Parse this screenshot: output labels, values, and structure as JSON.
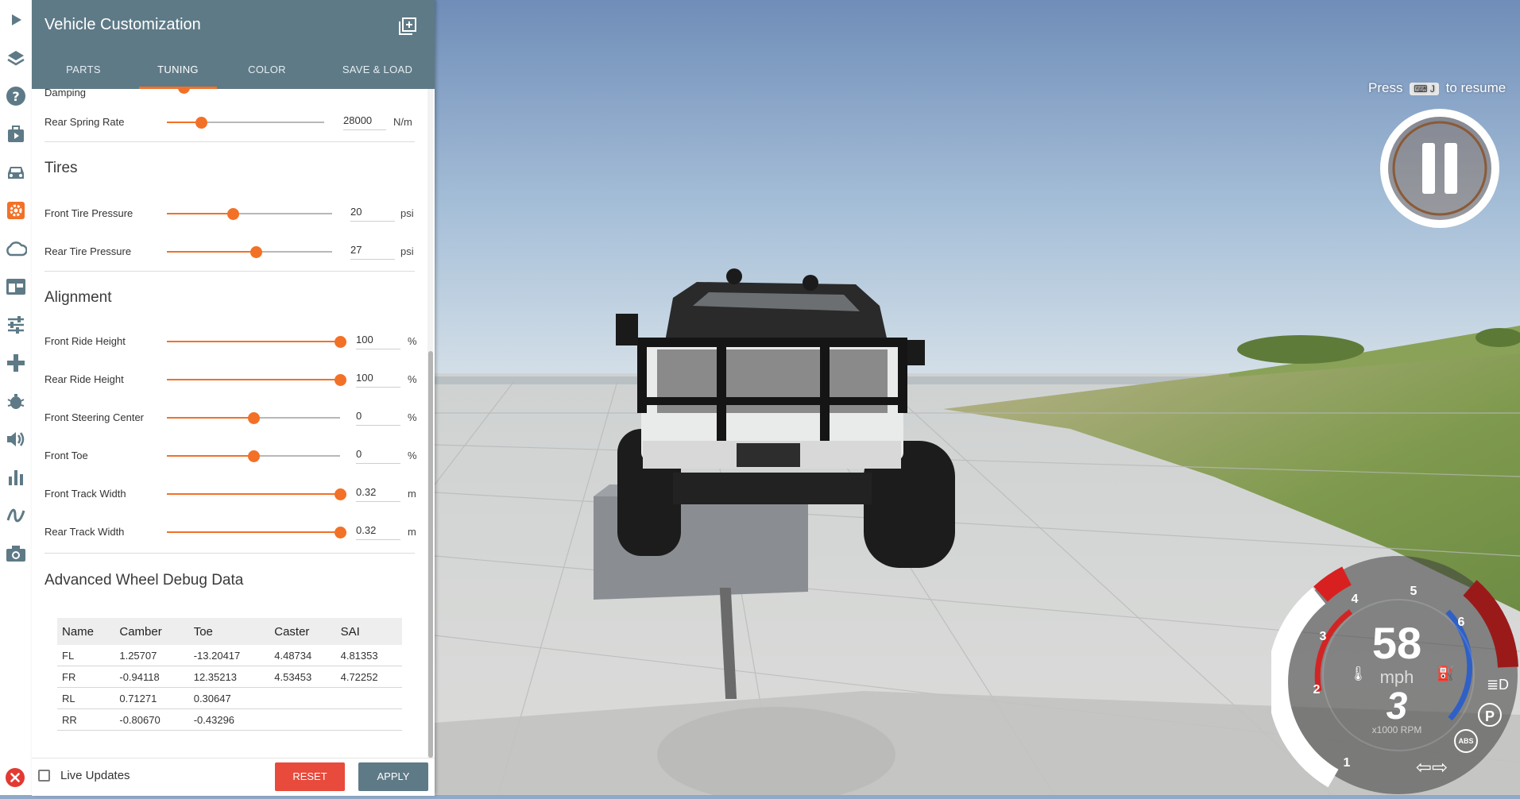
{
  "panel": {
    "title": "Vehicle Customization",
    "tabs": [
      {
        "label": "PARTS",
        "active": false
      },
      {
        "label": "TUNING",
        "active": true
      },
      {
        "label": "COLOR",
        "active": false
      },
      {
        "label": "SAVE & LOAD",
        "active": false
      }
    ]
  },
  "suspension": {
    "damping_label": "Damping",
    "rear_spring": {
      "label": "Rear Spring Rate",
      "value": "28000",
      "unit": "N/m",
      "fraction": 0.22
    }
  },
  "tires": {
    "heading": "Tires",
    "items": [
      {
        "label": "Front Tire Pressure",
        "value": "20",
        "unit": "psi",
        "fraction": 0.4
      },
      {
        "label": "Rear Tire Pressure",
        "value": "27",
        "unit": "psi",
        "fraction": 0.54
      }
    ]
  },
  "alignment": {
    "heading": "Alignment",
    "items": [
      {
        "label": "Front Ride Height",
        "value": "100",
        "unit": "%",
        "fraction": 1.0
      },
      {
        "label": "Rear Ride Height",
        "value": "100",
        "unit": "%",
        "fraction": 1.0
      },
      {
        "label": "Front Steering Center",
        "value": "0",
        "unit": "%",
        "fraction": 0.5
      },
      {
        "label": "Front Toe",
        "value": "0",
        "unit": "%",
        "fraction": 0.5
      },
      {
        "label": "Front Track Width",
        "value": "0.32",
        "unit": "m",
        "fraction": 1.0
      },
      {
        "label": "Rear Track Width",
        "value": "0.32",
        "unit": "m",
        "fraction": 1.0
      }
    ]
  },
  "debug": {
    "heading": "Advanced Wheel Debug Data",
    "columns": [
      "Name",
      "Camber",
      "Toe",
      "Caster",
      "SAI"
    ],
    "rows": [
      [
        "FL",
        "1.25707",
        "-13.20417",
        "4.48734",
        "4.81353"
      ],
      [
        "FR",
        "-0.94118",
        "12.35213",
        "4.53453",
        "4.72252"
      ],
      [
        "RL",
        "0.71271",
        "0.30647",
        "",
        ""
      ],
      [
        "RR",
        "-0.80670",
        "-0.43296",
        "",
        ""
      ]
    ]
  },
  "footer": {
    "live_updates_label": "Live Updates",
    "live_updates_checked": false,
    "reset_label": "RESET",
    "apply_label": "APPLY"
  },
  "hud": {
    "press_label": "Press",
    "key_label": "J",
    "resume_label": "to resume",
    "speed": "58",
    "speed_unit": "mph",
    "gear": "3",
    "rpm_label": "x1000 RPM",
    "rpm_ticks": [
      "1",
      "2",
      "3",
      "4",
      "5",
      "6"
    ],
    "park_label": "P",
    "abs_label": "ABS"
  },
  "colors": {
    "accent": "#f27127",
    "header": "#5e7a86",
    "reset": "#e84a3c",
    "apply": "#5e7a86"
  },
  "icons": {
    "sidebar": [
      "play-icon",
      "layers-icon",
      "help-icon",
      "scenario-icon",
      "vehicle-icon",
      "vehicle-config-icon",
      "cloud-icon",
      "ui-apps-icon",
      "options-icon",
      "controls-icon",
      "debug-icon",
      "audio-icon",
      "stats-icon",
      "flowgraph-icon",
      "camera-icon"
    ]
  }
}
